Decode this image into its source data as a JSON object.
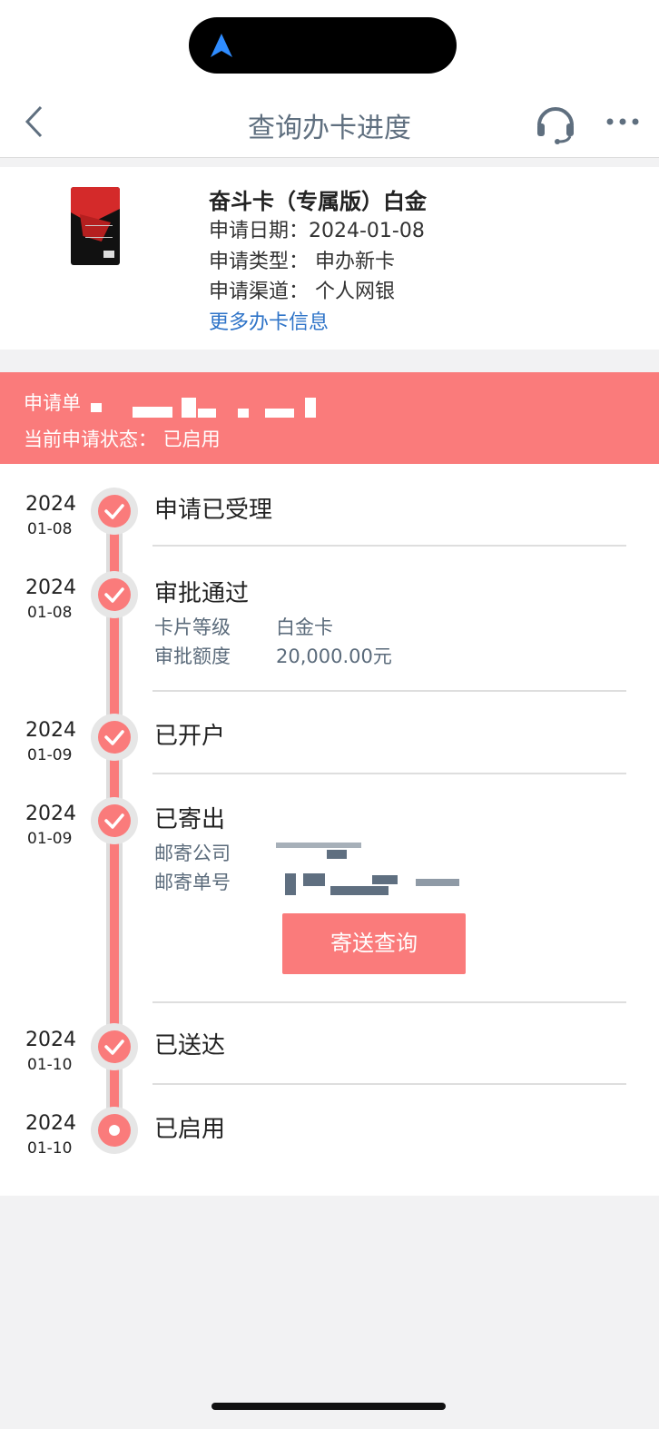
{
  "nav": {
    "title": "查询办卡进度",
    "back_icon": "chevron-left-icon",
    "service_icon": "headset-icon",
    "more_icon": "more-dots-icon"
  },
  "card": {
    "name": "奋斗卡（专属版）白金",
    "apply_date": "申请日期：2024-01-08",
    "apply_type": "申请类型：  申办新卡",
    "apply_channel": "申请渠道：  个人网银",
    "more_link": "更多办卡信息"
  },
  "banner": {
    "app_no_label": "申请单",
    "status_line": "当前申请状态：   已启用"
  },
  "steps": [
    {
      "year": "2024",
      "md": "01-08",
      "title": "申请已受理"
    },
    {
      "year": "2024",
      "md": "01-08",
      "title": "审批通过",
      "details": [
        {
          "label": "卡片等级",
          "value": "白金卡"
        },
        {
          "label": "审批额度",
          "value": "20,000.00元"
        }
      ]
    },
    {
      "year": "2024",
      "md": "01-09",
      "title": "已开户"
    },
    {
      "year": "2024",
      "md": "01-09",
      "title": "已寄出",
      "details": [
        {
          "label": "邮寄公司",
          "value": ""
        },
        {
          "label": "邮寄单号",
          "value": ""
        }
      ],
      "button": "寄送查询"
    },
    {
      "year": "2024",
      "md": "01-10",
      "title": "已送达"
    },
    {
      "year": "2024",
      "md": "01-10",
      "title": "已启用"
    }
  ],
  "colors": {
    "accent": "#fa7b7b",
    "link": "#2f74c8",
    "nav_title": "#5f6f7f"
  }
}
